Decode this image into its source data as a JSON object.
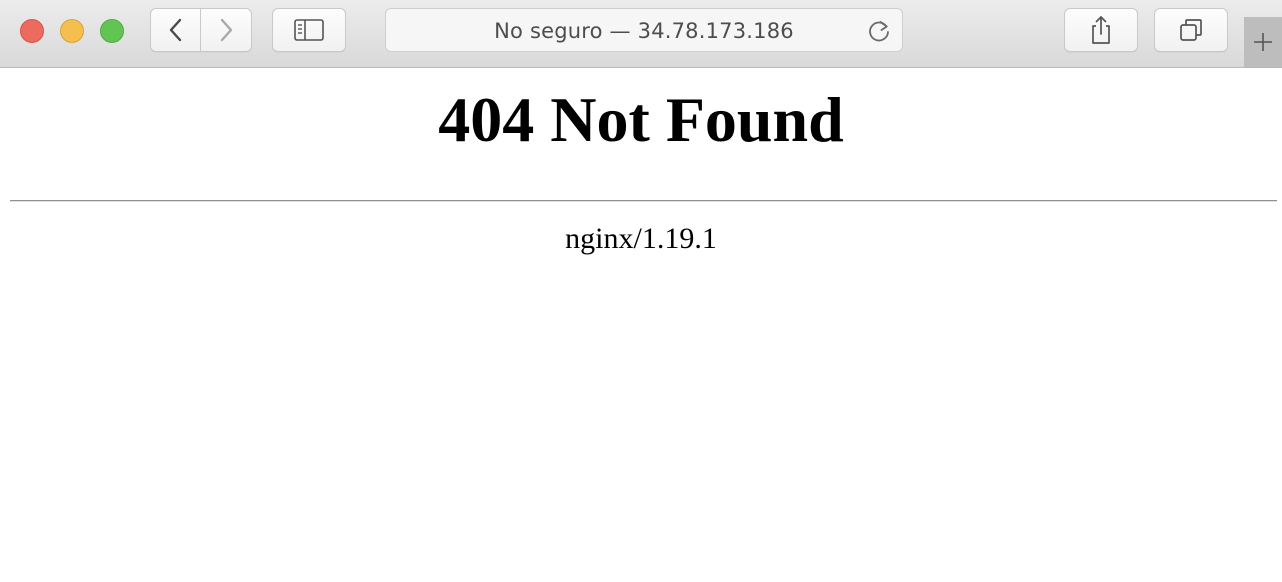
{
  "browser": {
    "address_bar": {
      "text": "No seguro — 34.78.173.186"
    },
    "icons": {
      "back": "chevron-left-icon",
      "forward": "chevron-right-icon",
      "sidebar": "sidebar-icon",
      "reload": "reload-icon",
      "share": "share-icon",
      "tabs": "tabs-overview-icon",
      "new_tab": "plus-icon"
    },
    "colors": {
      "close": "#ed6a5e",
      "minimize": "#f5bf4f",
      "maximize": "#61c554"
    }
  },
  "page": {
    "heading": "404 Not Found",
    "server_signature": "nginx/1.19.1"
  }
}
